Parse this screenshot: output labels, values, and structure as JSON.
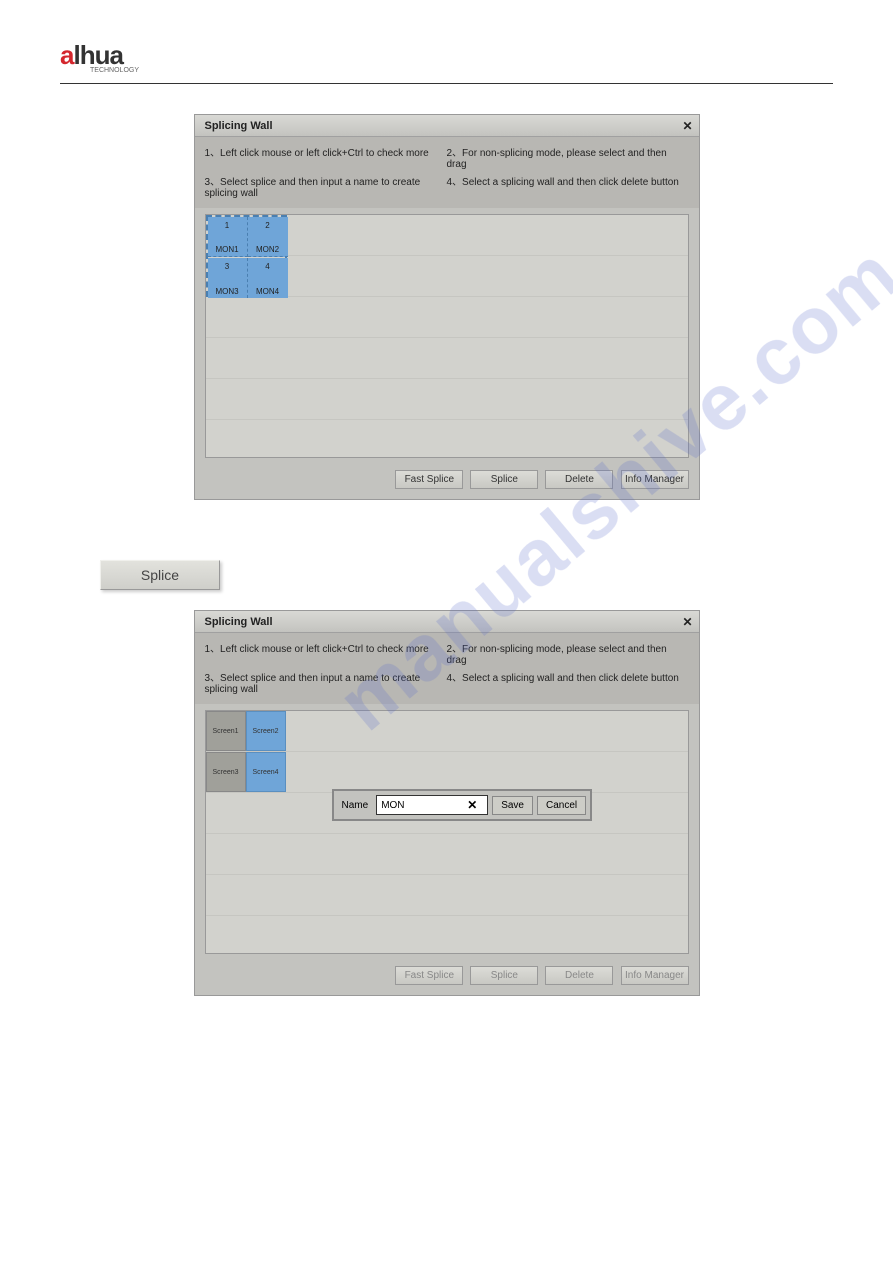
{
  "logo": {
    "brand": "alhua",
    "sub": "TECHNOLOGY"
  },
  "watermark": "manualshive.com",
  "dialog1": {
    "title": "Splicing Wall",
    "instructions": {
      "i1": "1、Left click mouse or left click+Ctrl to check more",
      "i2": "2、For non-splicing mode, please select and then drag",
      "i3": "3、Select splice and then input a name to create splicing wall",
      "i4": "4、Select a splicing wall and then click delete button"
    },
    "cells": {
      "n1": "1",
      "n2": "2",
      "n3": "3",
      "n4": "4",
      "m1": "MON1",
      "m2": "MON2",
      "m3": "MON3",
      "m4": "MON4"
    },
    "buttons": {
      "fast": "Fast Splice",
      "splice": "Splice",
      "delete": "Delete",
      "info": "Info Manager"
    }
  },
  "standalone_btn": "Splice",
  "dialog2": {
    "title": "Splicing Wall",
    "instructions": {
      "i1": "1、Left click mouse or left click+Ctrl to check more",
      "i2": "2、For non-splicing mode, please select and then drag",
      "i3": "3、Select splice and then input a name to create splicing wall",
      "i4": "4、Select a splicing wall and then click delete button"
    },
    "cells": {
      "s1": "Screen1",
      "s2": "Screen2",
      "s3": "Screen3",
      "s4": "Screen4"
    },
    "name_popup": {
      "label": "Name",
      "value": "MON",
      "save": "Save",
      "cancel": "Cancel"
    },
    "buttons": {
      "fast": "Fast Splice",
      "splice": "Splice",
      "delete": "Delete",
      "info": "Info Manager"
    }
  }
}
